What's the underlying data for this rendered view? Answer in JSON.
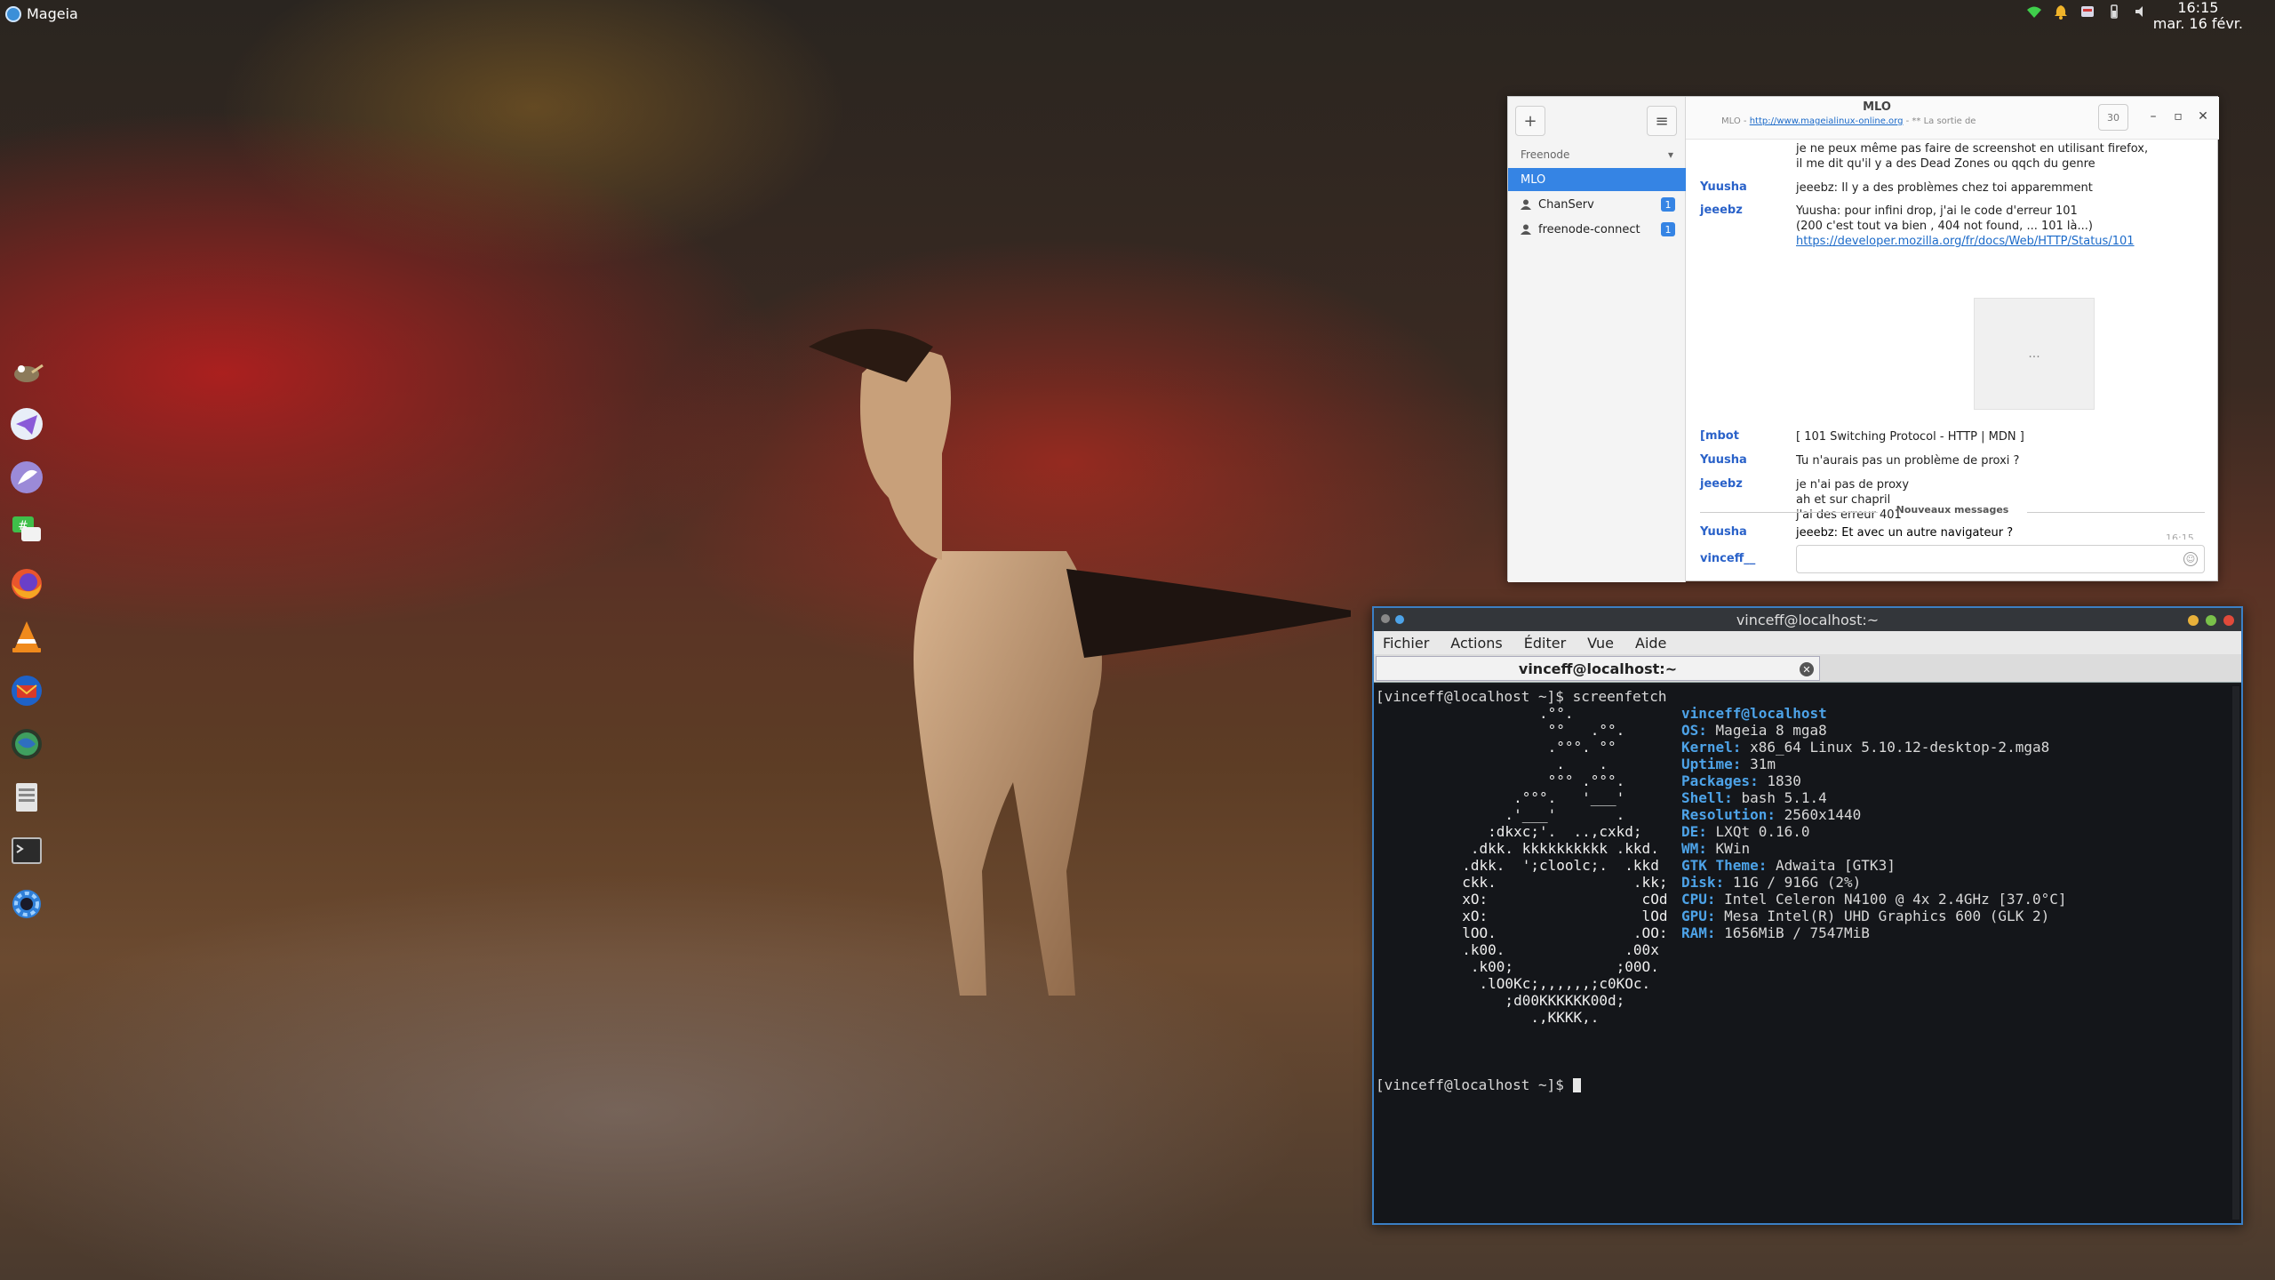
{
  "top_panel": {
    "app_menu_label": "Mageia",
    "clock_time": "16:15",
    "clock_date": "mar. 16 févr."
  },
  "dock": {
    "items": [
      "gimp-icon",
      "telegram-icon",
      "kde-icon",
      "hexchat-icon",
      "firefox-icon",
      "vlc-icon",
      "thunderbird-icon",
      "globe-icon",
      "file-manager-icon",
      "terminal-icon",
      "settings-icon"
    ]
  },
  "chat": {
    "network": "Freenode",
    "channels": [
      {
        "name": "MLO",
        "badge": ""
      },
      {
        "name": "ChanServ",
        "badge": "1"
      },
      {
        "name": "freenode-connect",
        "badge": "1"
      }
    ],
    "title": "MLO",
    "topic_prefix": "MLO -",
    "topic_link": "http://www.mageialinux-online.org",
    "topic_suffix": "- ** La sortie de",
    "user_count": "30",
    "messages": [
      {
        "nick": "",
        "lines": [
          "je ne peux même pas faire de screenshot en utilisant firefox,",
          "il me dit qu'il y a des Dead Zones ou qqch du genre"
        ]
      },
      {
        "nick": "Yuusha",
        "lines": [
          "jeeebz: Il y a des problèmes chez toi apparemment"
        ]
      },
      {
        "nick": "jeeebz",
        "lines": [
          "Yuusha: pour infini drop, j'ai le code d'erreur 101",
          "(200 c'est tout va bien , 404 not found, ... 101 là...)"
        ],
        "link": "https://developer.mozilla.org/fr/docs/Web/HTTP/Status/101"
      },
      {
        "nick": "[mbot",
        "lines": [
          "[ 101 Switching Protocol - HTTP | MDN ]"
        ]
      },
      {
        "nick": "Yuusha",
        "lines": [
          "Tu n'aurais pas un problème de proxi ?"
        ]
      },
      {
        "nick": "jeeebz",
        "lines": [
          "je n'ai pas de proxy",
          "ah et sur chapril",
          "j'ai des erreur 401"
        ]
      },
      {
        "nick": "Yuusha",
        "lines": [
          "jeeebz: Et avec un autre navigateur ?"
        ]
      }
    ],
    "preview_glyph": "...",
    "last_time": "16:15",
    "new_messages_label": "Nouveaux messages",
    "own_nick": "vinceff__",
    "input_value": ""
  },
  "terminal": {
    "title": "vinceff@localhost:~",
    "menu": [
      "Fichier",
      "Actions",
      "Éditer",
      "Vue",
      "Aide"
    ],
    "tab_label": "vinceff@localhost:~",
    "prompt": "[vinceff@localhost ~]$",
    "command": "screenfetch",
    "logo": [
      "           .°°.",
      "            °°   .°°.",
      "            .°°°. °°",
      "             .    .",
      "            °°° .°°°.",
      "        .°°°.   '___'",
      "       .'___'       .",
      "     :dkxc;'.  ..,cxkd;",
      "   .dkk. kkkkkkkkkk .kkd.",
      "  .dkk.  ';cloolc;.  .kkd",
      "  ckk.                .kk;",
      "  xO:                  cOd",
      "  xO:                  lOd",
      "  lOO.                .OO:",
      "  .k00.              .00x",
      "   .k00;            ;00O.",
      "    .lO0Kc;,,,,,,;c0KOc.",
      "       ;d00KKKKKK00d;",
      "          .,KKKK,."
    ],
    "info": [
      {
        "label": "",
        "value": "vinceff@localhost"
      },
      {
        "label": "OS:",
        "value": "Mageia 8 mga8"
      },
      {
        "label": "Kernel:",
        "value": "x86_64 Linux 5.10.12-desktop-2.mga8"
      },
      {
        "label": "Uptime:",
        "value": "31m"
      },
      {
        "label": "Packages:",
        "value": "1830"
      },
      {
        "label": "Shell:",
        "value": "bash 5.1.4"
      },
      {
        "label": "Resolution:",
        "value": "2560x1440"
      },
      {
        "label": "DE:",
        "value": "LXQt 0.16.0"
      },
      {
        "label": "WM:",
        "value": "KWin"
      },
      {
        "label": "GTK Theme:",
        "value": "Adwaita [GTK3]"
      },
      {
        "label": "Disk:",
        "value": "11G / 916G (2%)"
      },
      {
        "label": "CPU:",
        "value": "Intel Celeron N4100 @ 4x 2.4GHz [37.0°C]"
      },
      {
        "label": "GPU:",
        "value": "Mesa Intel(R) UHD Graphics 600 (GLK 2)"
      },
      {
        "label": "RAM:",
        "value": "1656MiB / 7547MiB"
      }
    ]
  },
  "colors": {
    "accent": "#3584e4",
    "nick": "#2a62c9",
    "terminal_label": "#4da3e8",
    "terminal_border": "#3b7fc4"
  }
}
